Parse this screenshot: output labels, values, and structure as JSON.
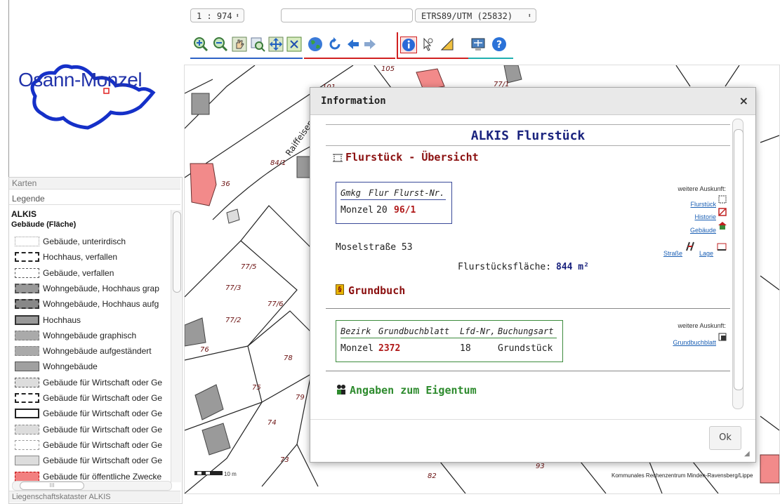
{
  "toolbar": {
    "scale": "1 : 974",
    "search_value": "",
    "crs": "ETRS89/UTM (25832)"
  },
  "logo": {
    "text": "Osann-Monzel"
  },
  "layers": {
    "karten_label": "Karten",
    "legende_label": "Legende",
    "group_title": "ALKIS",
    "group_subtitle": "Gebäude (Fläche)",
    "items": [
      "Gebäude, unterirdisch",
      "Hochhaus, verfallen",
      "Gebäude, verfallen",
      "Wohngebäude, Hochhaus grap",
      "Wohngebäude, Hochhaus aufg",
      "Hochhaus",
      "Wohngebäude graphisch",
      "Wohngebäude aufgeständert",
      "Wohngebäude",
      "Gebäude für Wirtschaft oder Ge",
      "Gebäude für Wirtschaft oder Ge",
      "Gebäude für Wirtschaft oder Ge",
      "Gebäude für Wirtschaft oder Ge",
      "Gebäude für Wirtschaft oder Ge",
      "Gebäude für Wirtschaft oder Ge",
      "Gebäude für öffentliche Zwecke"
    ],
    "footer": "Liegenschaftskataster ALKIS",
    "hscroll_label": "III"
  },
  "map": {
    "labels": [
      "105",
      "77/1",
      "101",
      "Raiffeisenstraße",
      "84/1",
      "36",
      "77/5",
      "77/3",
      "77/6",
      "77/2",
      "78",
      "76",
      "75",
      "79",
      "74",
      "73",
      "93",
      "82"
    ],
    "scalebar": "10 m",
    "copyright": "Kommunales Rechenzentrum Minden-Ravensberg/Lippe"
  },
  "dialog": {
    "title": "Information",
    "close": "×",
    "heading": "ALKIS Flurstück",
    "section1": "Flurstück - Übersicht",
    "table1": {
      "headers": [
        "Gmkg",
        "Flur",
        "Flurst-Nr."
      ],
      "row": [
        "Monzel",
        "20",
        "96/1"
      ]
    },
    "more_info_label": "weitere Auskunft:",
    "links1": [
      "Flurstück",
      "Historie",
      "Gebäude"
    ],
    "links_street": [
      "Straße",
      "Lage"
    ],
    "address": "Moselstraße 53",
    "area_label": "Flurstücksfläche:",
    "area_value": "844 m²",
    "section2": "Grundbuch",
    "table2": {
      "headers": [
        "Bezirk",
        "Grundbuchblatt",
        "Lfd-Nr,",
        "Buchungsart"
      ],
      "row": [
        "Monzel",
        "2372",
        "18",
        "Grundstück"
      ]
    },
    "more_info_label2": "weitere Auskunft:",
    "link_grundbuch": "Grundbuchblatt",
    "section3": "Angaben zum Eigentum",
    "ok": "Ok"
  },
  "colors": {
    "heading_blue": "#1a237e",
    "section_red": "#8b1010",
    "value_red": "#b01818",
    "eigentum_green": "#2e8b2e",
    "table1_border": "#3a4a99",
    "table2_border": "#3d8b3d",
    "building_red": "#f08080"
  }
}
